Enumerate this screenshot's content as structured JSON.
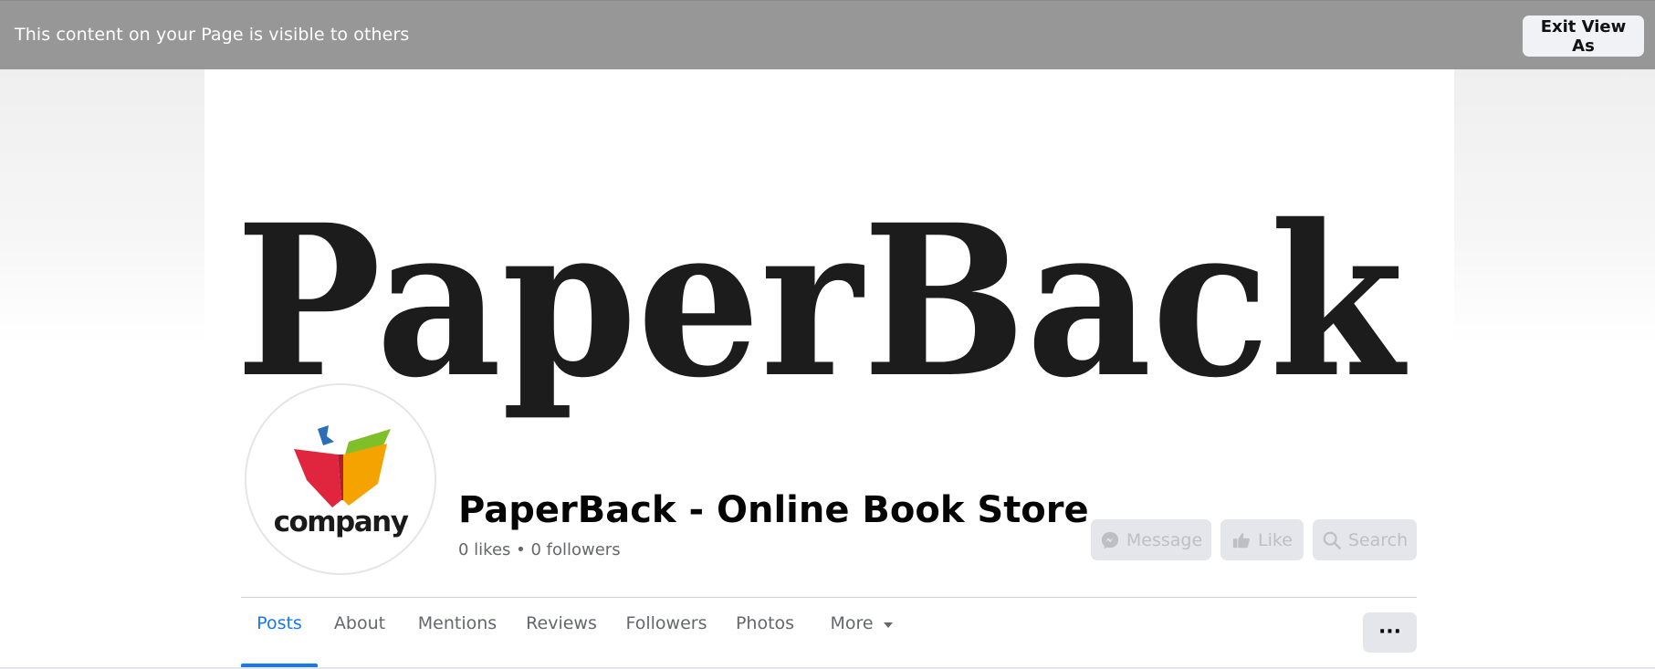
{
  "view_as_bar": {
    "message": "This content on your Page is visible to others",
    "exit_label": "Exit View As"
  },
  "cover": {
    "wordmark": "PaperBack"
  },
  "profile": {
    "logo_text": "company",
    "page_name": "PaperBack - Online Book Store",
    "stats": "0 likes • 0 followers"
  },
  "actions": {
    "message_label": "Message",
    "like_label": "Like",
    "search_label": "Search"
  },
  "tabs": [
    {
      "label": "Posts",
      "active": true
    },
    {
      "label": "About"
    },
    {
      "label": "Mentions"
    },
    {
      "label": "Reviews"
    },
    {
      "label": "Followers"
    },
    {
      "label": "Photos"
    },
    {
      "label": "More"
    }
  ],
  "overflow_label": "···",
  "icons": {
    "message": "messenger-icon",
    "like": "thumbs-up-icon",
    "search": "search-icon",
    "more": "caret-down-icon"
  },
  "colors": {
    "accent": "#1877f2",
    "bar": "#979797",
    "disabled_text": "#bcc0c4",
    "button_bg": "#e4e6eb"
  }
}
